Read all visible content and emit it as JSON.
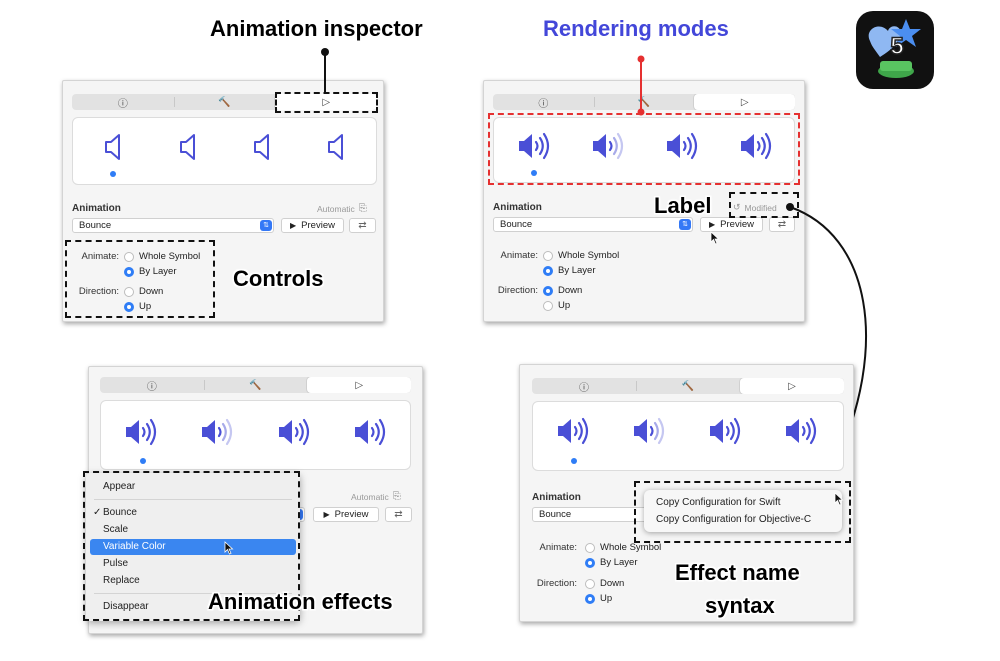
{
  "callouts": {
    "animation_inspector": "Animation inspector",
    "rendering_modes": "Rendering modes",
    "label": "Label",
    "controls": "Controls",
    "animation_effects": "Animation effects",
    "effect_name_syntax_line1": "Effect name",
    "effect_name_syntax_line2": "syntax"
  },
  "inspector": {
    "tabs": [
      "ⓘ",
      "🔨",
      "▷"
    ],
    "section_label": "Animation",
    "automatic_label": "Automatic",
    "modified_label": "Modified",
    "animation_value": "Bounce",
    "preview_label": "Preview",
    "animate_label": "Animate:",
    "whole_symbol": "Whole Symbol",
    "by_layer": "By Layer",
    "direction_label": "Direction:",
    "down": "Down",
    "up": "Up"
  },
  "effects_menu": {
    "items": [
      "Appear",
      "Bounce",
      "Scale",
      "Variable Color",
      "Pulse",
      "Replace",
      "Disappear"
    ],
    "checked": "Bounce",
    "highlighted": "Variable Color"
  },
  "context_menu": {
    "items": [
      "Copy Configuration for Swift",
      "Copy Configuration for Objective-C"
    ]
  },
  "app_icon": {
    "badge": "5",
    "icon": "sf-symbols-app-icon"
  },
  "colors": {
    "symbol_purple": "#4a4fd6",
    "accent_blue": "#2f7df6",
    "dash_red": "#e53030",
    "callout_blue": "#4347d9"
  }
}
